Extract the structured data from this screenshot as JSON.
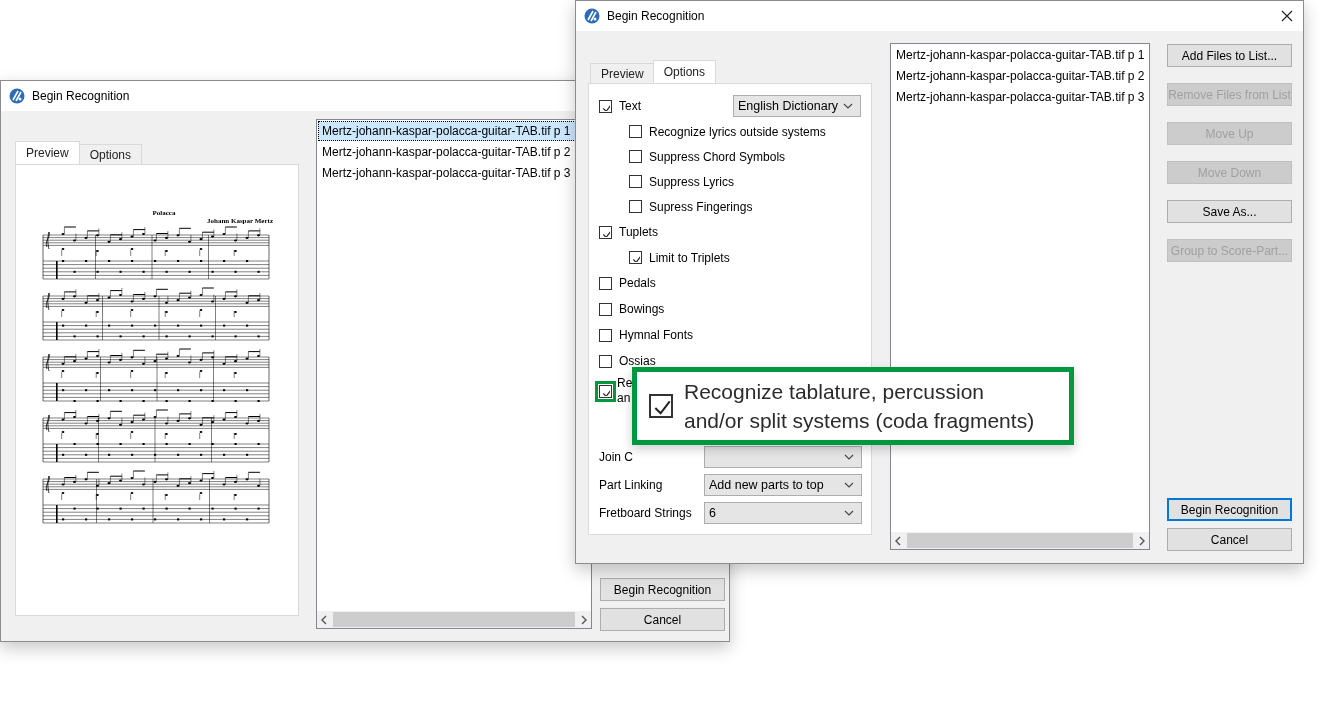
{
  "back_window": {
    "title": "Begin Recognition",
    "tabs": [
      {
        "label": "Preview",
        "selected": true
      },
      {
        "label": "Options",
        "selected": false
      }
    ],
    "preview": {
      "title": "Polacca",
      "composer": "Johann Kaspar Mertz"
    },
    "files": [
      {
        "name": "Mertz-johann-kaspar-polacca-guitar-TAB.tif p  1",
        "selected": true
      },
      {
        "name": "Mertz-johann-kaspar-polacca-guitar-TAB.tif p  2",
        "selected": false
      },
      {
        "name": "Mertz-johann-kaspar-polacca-guitar-TAB.tif p  3",
        "selected": false
      }
    ],
    "dialog_buttons": [
      {
        "label": "Begin Recognition",
        "disabled": false,
        "default": false
      },
      {
        "label": "Cancel",
        "disabled": false,
        "default": false
      }
    ]
  },
  "front_window": {
    "title": "Begin Recognition",
    "tabs": [
      {
        "label": "Preview",
        "selected": false
      },
      {
        "label": "Options",
        "selected": true
      }
    ],
    "options": [
      {
        "label": "Text",
        "checked": true,
        "dropdown": "English Dictionary",
        "children": [
          {
            "label": "Recognize lyrics outside systems",
            "checked": false
          },
          {
            "label": "Suppress Chord Symbols",
            "checked": false
          },
          {
            "label": "Suppress Lyrics",
            "checked": false
          },
          {
            "label": "Supress Fingerings",
            "checked": false
          }
        ]
      },
      {
        "label": "Tuplets",
        "checked": true,
        "children": [
          {
            "label": "Limit to Triplets",
            "checked": true
          }
        ]
      },
      {
        "label": "Pedals",
        "checked": false
      },
      {
        "label": "Bowings",
        "checked": false
      },
      {
        "label": "Hymnal Fonts",
        "checked": false
      },
      {
        "label": "Ossias",
        "checked": false
      },
      {
        "label_lines": [
          "Re",
          "an"
        ],
        "checked": true,
        "highlighted": true
      }
    ],
    "fields": [
      {
        "label": "Join C"
      },
      {
        "label": "Part Linking",
        "value": "Add new parts to top"
      },
      {
        "label": "Fretboard Strings",
        "value": "6"
      }
    ],
    "files": [
      {
        "name": "Mertz-johann-kaspar-polacca-guitar-TAB.tif p  1",
        "selected": false
      },
      {
        "name": "Mertz-johann-kaspar-polacca-guitar-TAB.tif p  2",
        "selected": false
      },
      {
        "name": "Mertz-johann-kaspar-polacca-guitar-TAB.tif p  3",
        "selected": false
      }
    ],
    "side_buttons": [
      {
        "label": "Add Files to List...",
        "disabled": false,
        "default": false
      },
      {
        "label": "Remove Files from List",
        "disabled": true,
        "default": false
      },
      {
        "label": "Move Up",
        "disabled": true,
        "default": false
      },
      {
        "label": "Move Down",
        "disabled": true,
        "default": false
      },
      {
        "label": "Save As...",
        "disabled": false,
        "default": false
      },
      {
        "label": "Group to Score-Part...",
        "disabled": true,
        "default": false
      }
    ],
    "dialog_buttons": [
      {
        "label": "Begin Recognition",
        "disabled": false,
        "default": true
      },
      {
        "label": "Cancel",
        "disabled": false,
        "default": false
      }
    ]
  },
  "callout": {
    "label_lines": [
      "Recognize tablature, percussion",
      "and/or split systems (coda fragments)"
    ],
    "checked": true
  }
}
